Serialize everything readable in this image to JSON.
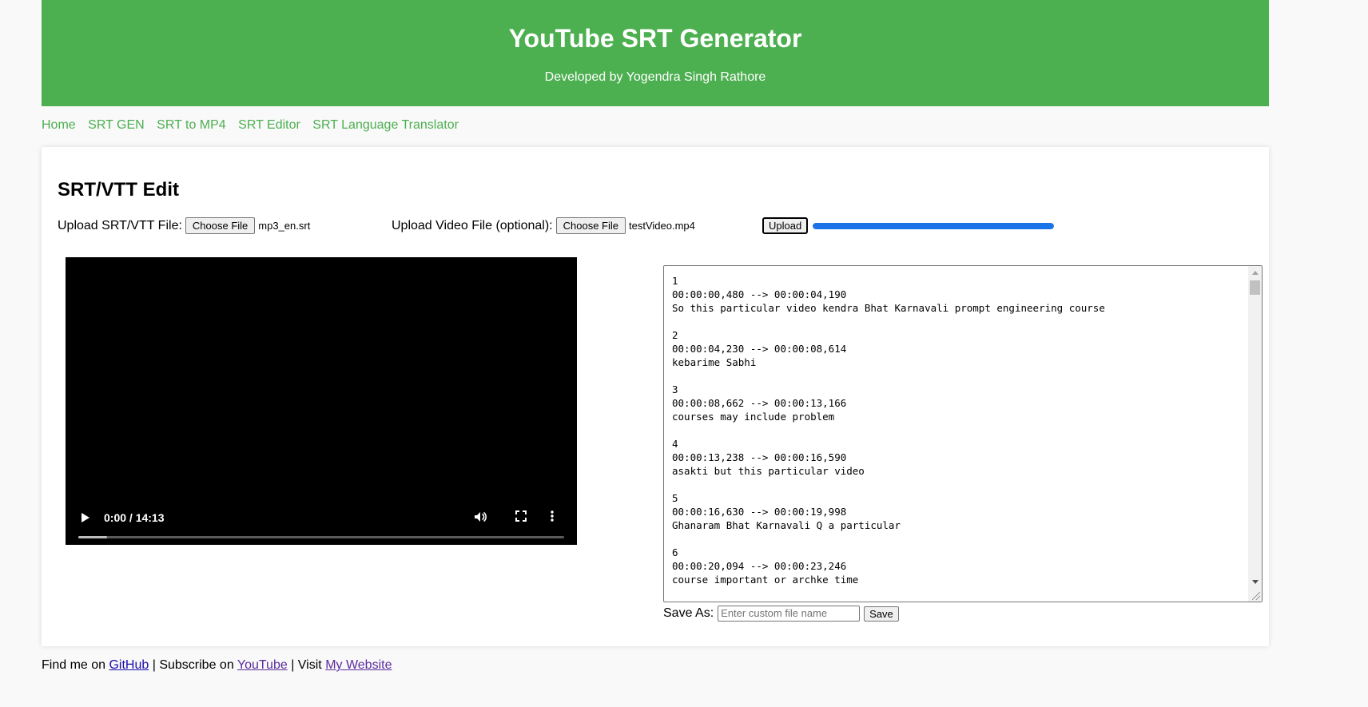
{
  "header": {
    "title": "YouTube SRT Generator",
    "subtitle": "Developed by Yogendra Singh Rathore"
  },
  "nav": {
    "items": [
      "Home",
      "SRT GEN",
      "SRT to MP4",
      "SRT Editor",
      "SRT Language Translator"
    ]
  },
  "editor_page": {
    "heading": "SRT/VTT Edit",
    "srt_upload": {
      "label": "Upload SRT/VTT File:",
      "button": "Choose File",
      "file_name": "mp3_en.srt"
    },
    "video_upload": {
      "label": "Upload Video File (optional):",
      "button": "Choose File",
      "file_name": "testVideo.mp4"
    },
    "upload_button": "Upload",
    "upload_progress": 1.0,
    "video": {
      "time": "0:00 / 14:13",
      "buffered_fraction": 0.06
    },
    "srt_text": "1\n00:00:00,480 --> 00:00:04,190\nSo this particular video kendra Bhat Karnavali prompt engineering course\n\n2\n00:00:04,230 --> 00:00:08,614\nkebarime Sabhi\n\n3\n00:00:08,662 --> 00:00:13,166\ncourses may include problem\n\n4\n00:00:13,238 --> 00:00:16,590\nasakti but this particular video\n\n5\n00:00:16,630 --> 00:00:19,998\nGhanaram Bhat Karnavali Q a particular\n\n6\n00:00:20,094 --> 00:00:23,246\ncourse important or archke time",
    "save": {
      "label": "Save As:",
      "placeholder": "Enter custom file name",
      "button": "Save"
    }
  },
  "footer": {
    "prefix": "Find me on ",
    "github": "GitHub",
    "sep1": " | Subscribe on ",
    "youtube": "YouTube",
    "sep2": " | Visit ",
    "website": "My Website"
  },
  "colors": {
    "brand_green": "#4caf50",
    "progress_blue": "#1a73e8"
  }
}
